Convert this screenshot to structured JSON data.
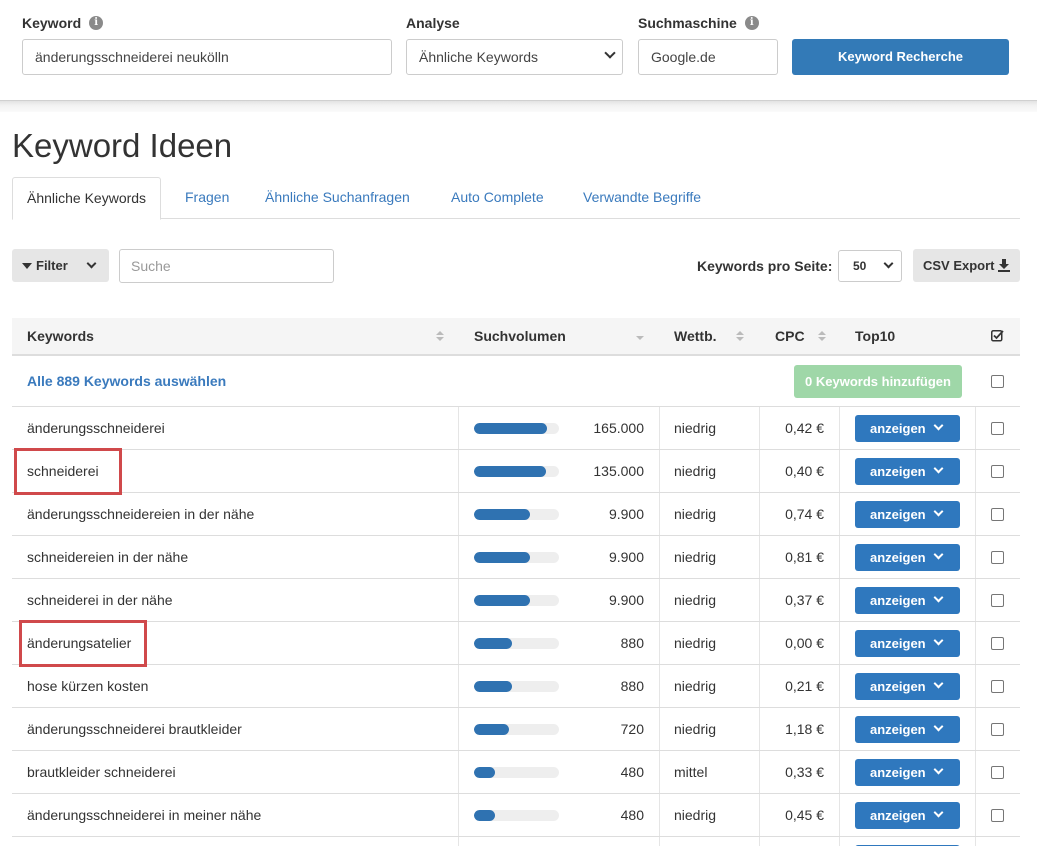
{
  "search": {
    "keyword_label": "Keyword",
    "keyword_value": "änderungsschneiderei neukölln",
    "analyse_label": "Analyse",
    "analyse_value": "Ähnliche Keywords",
    "engine_label": "Suchmaschine",
    "engine_value": "Google.de",
    "submit_label": "Keyword Recherche",
    "info_glyph": "i"
  },
  "page": {
    "title": "Keyword Ideen"
  },
  "tabs": [
    {
      "label": "Ähnliche Keywords",
      "active": true
    },
    {
      "label": "Fragen",
      "active": false
    },
    {
      "label": "Ähnliche Suchanfragen",
      "active": false
    },
    {
      "label": "Auto Complete",
      "active": false
    },
    {
      "label": "Verwandte Begriffe",
      "active": false
    }
  ],
  "toolbar": {
    "filter_label": "Filter",
    "search_placeholder": "Suche",
    "per_page_label": "Keywords pro Seite:",
    "per_page_value": "50",
    "csv_label": "CSV Export"
  },
  "table": {
    "headers": {
      "keywords": "Keywords",
      "volume": "Suchvolumen",
      "competition": "Wettb.",
      "cpc": "CPC",
      "top10": "Top10"
    },
    "select_all_label": "Alle 889 Keywords auswählen",
    "add_label": "0 Keywords hinzufügen",
    "show_label": "anzeigen",
    "rows": [
      {
        "keyword": "änderungsschneiderei",
        "volume": "165.000",
        "volume_fill": 0.86,
        "competition": "niedrig",
        "cpc": "0,42 €",
        "highlighted": false
      },
      {
        "keyword": "schneiderei",
        "volume": "135.000",
        "volume_fill": 0.85,
        "competition": "niedrig",
        "cpc": "0,40 €",
        "highlighted": true
      },
      {
        "keyword": "änderungsschneidereien in der nähe",
        "volume": "9.900",
        "volume_fill": 0.66,
        "competition": "niedrig",
        "cpc": "0,74 €",
        "highlighted": false
      },
      {
        "keyword": "schneidereien in der nähe",
        "volume": "9.900",
        "volume_fill": 0.66,
        "competition": "niedrig",
        "cpc": "0,81 €",
        "highlighted": false
      },
      {
        "keyword": "schneiderei in der nähe",
        "volume": "9.900",
        "volume_fill": 0.66,
        "competition": "niedrig",
        "cpc": "0,37 €",
        "highlighted": false
      },
      {
        "keyword": "änderungsatelier",
        "volume": "880",
        "volume_fill": 0.45,
        "competition": "niedrig",
        "cpc": "0,00 €",
        "highlighted": true
      },
      {
        "keyword": "hose kürzen kosten",
        "volume": "880",
        "volume_fill": 0.45,
        "competition": "niedrig",
        "cpc": "0,21 €",
        "highlighted": false
      },
      {
        "keyword": "änderungsschneiderei brautkleider",
        "volume": "720",
        "volume_fill": 0.41,
        "competition": "niedrig",
        "cpc": "1,18 €",
        "highlighted": false
      },
      {
        "keyword": "brautkleider schneiderei",
        "volume": "480",
        "volume_fill": 0.25,
        "competition": "mittel",
        "cpc": "0,33 €",
        "highlighted": false
      },
      {
        "keyword": "änderungsschneiderei in meiner nähe",
        "volume": "480",
        "volume_fill": 0.25,
        "competition": "niedrig",
        "cpc": "0,45 €",
        "highlighted": false
      },
      {
        "keyword": "",
        "volume": "",
        "volume_fill": 0,
        "competition": "",
        "cpc": "",
        "highlighted": false
      }
    ]
  },
  "colors": {
    "primary": "#337ab7",
    "link": "#3a7abd",
    "success_disabled": "#9fd7a8",
    "highlight": "#d0494b"
  }
}
